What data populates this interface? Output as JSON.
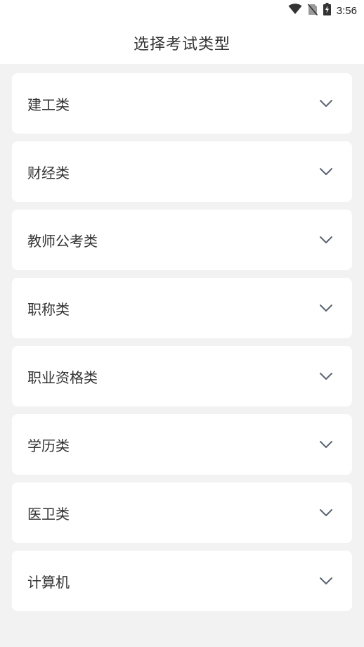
{
  "status_bar": {
    "time": "3:56",
    "icons": [
      "wifi-icon",
      "no-sim-icon",
      "battery-charging-icon"
    ]
  },
  "header": {
    "title": "选择考试类型"
  },
  "categories": [
    {
      "label": "建工类",
      "icon": "chevron-down-icon"
    },
    {
      "label": "财经类",
      "icon": "chevron-down-icon"
    },
    {
      "label": "教师公考类",
      "icon": "chevron-down-icon"
    },
    {
      "label": "职称类",
      "icon": "chevron-down-icon"
    },
    {
      "label": "职业资格类",
      "icon": "chevron-down-icon"
    },
    {
      "label": "学历类",
      "icon": "chevron-down-icon"
    },
    {
      "label": "医卫类",
      "icon": "chevron-down-icon"
    },
    {
      "label": "计算机",
      "icon": "chevron-down-icon"
    }
  ],
  "colors": {
    "background": "#f2f2f2",
    "card": "#ffffff",
    "text": "#333333",
    "chevron": "#5a6472"
  }
}
